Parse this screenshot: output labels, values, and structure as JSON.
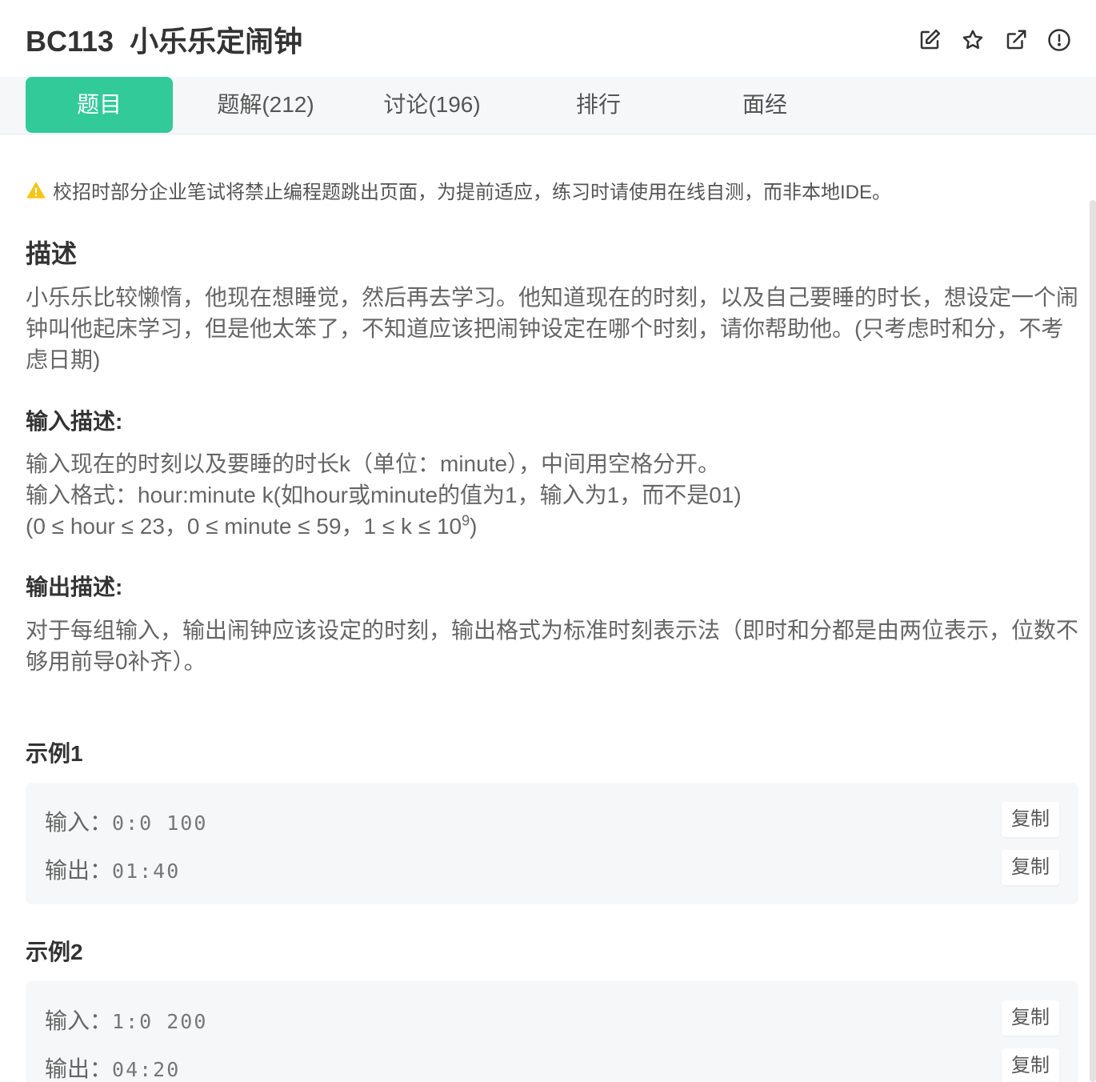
{
  "header": {
    "title": "BC113  小乐乐定闹钟"
  },
  "tabs": [
    {
      "label": "题目"
    },
    {
      "label": "题解(212)"
    },
    {
      "label": "讨论(196)"
    },
    {
      "label": "排行"
    },
    {
      "label": "面经"
    }
  ],
  "notice": "校招时部分企业笔试将禁止编程题跳出页面，为提前适应，练习时请使用在线自测，而非本地IDE。",
  "description": {
    "heading": "描述",
    "body": "小乐乐比较懒惰，他现在想睡觉，然后再去学习。他知道现在的时刻，以及自己要睡的时长，想设定一个闹钟叫他起床学习，但是他太笨了，不知道应该把闹钟设定在哪个时刻，请你帮助他。(只考虑时和分，不考虑日期)"
  },
  "input_desc": {
    "heading": "输入描述:",
    "line1": "输入现在的时刻以及要睡的时长k（单位：minute），中间用空格分开。",
    "line2": "输入格式：hour:minute k(如hour或minute的值为1，输入为1，而不是01)",
    "line3_prefix": "(0 ≤ hour ≤ 23，0 ≤ minute ≤ 59，1 ≤ k ≤ 10",
    "line3_sup": "9",
    "line3_suffix": ")"
  },
  "output_desc": {
    "heading": "输出描述:",
    "body": "对于每组输入，输出闹钟应该设定的时刻，输出格式为标准时刻表示法（即时和分都是由两位表示，位数不够用前导0补齐）。"
  },
  "examples": [
    {
      "heading": "示例1",
      "input_label": "输入：",
      "input_value": "0:0 100",
      "output_label": "输出：",
      "output_value": "01:40",
      "copy_label": "复制"
    },
    {
      "heading": "示例2",
      "input_label": "输入：",
      "input_value": "1:0 200",
      "output_label": "输出：",
      "output_value": "04:20",
      "copy_label": "复制"
    }
  ],
  "colors": {
    "accent": "#32ca99",
    "warning": "#f5c518",
    "panel": "#f6f7f8"
  },
  "icons": [
    "edit-icon",
    "star-icon",
    "share-icon",
    "report-icon",
    "warning-icon"
  ]
}
